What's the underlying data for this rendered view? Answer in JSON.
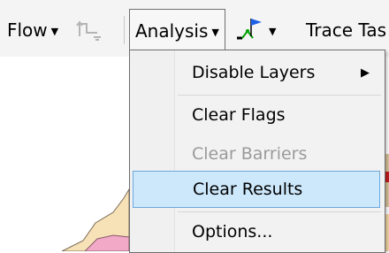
{
  "toolbar": {
    "flow_label": "Flow",
    "analysis_label": "Analysis",
    "trace_label": "Trace Tas",
    "dropdown_arrow": "▼"
  },
  "menu": {
    "items": [
      {
        "label": "Disable Layers",
        "submenu_arrow": "▶",
        "enabled": true
      },
      {
        "label": "Clear Flags",
        "enabled": true
      },
      {
        "label": "Clear Barriers",
        "enabled": false
      },
      {
        "label": "Clear Results",
        "enabled": true,
        "highlighted": true
      },
      {
        "label": "Options...",
        "enabled": true
      }
    ]
  },
  "colors": {
    "highlight_bg": "#cde8fb",
    "highlight_border": "#6aa8de",
    "disabled_text": "#9a9a9a",
    "flag_blue": "#1e5ee6"
  },
  "icons": [
    "flow-direction-icon",
    "flag-icon",
    "dropdown-arrow-icon",
    "submenu-arrow-icon"
  ]
}
